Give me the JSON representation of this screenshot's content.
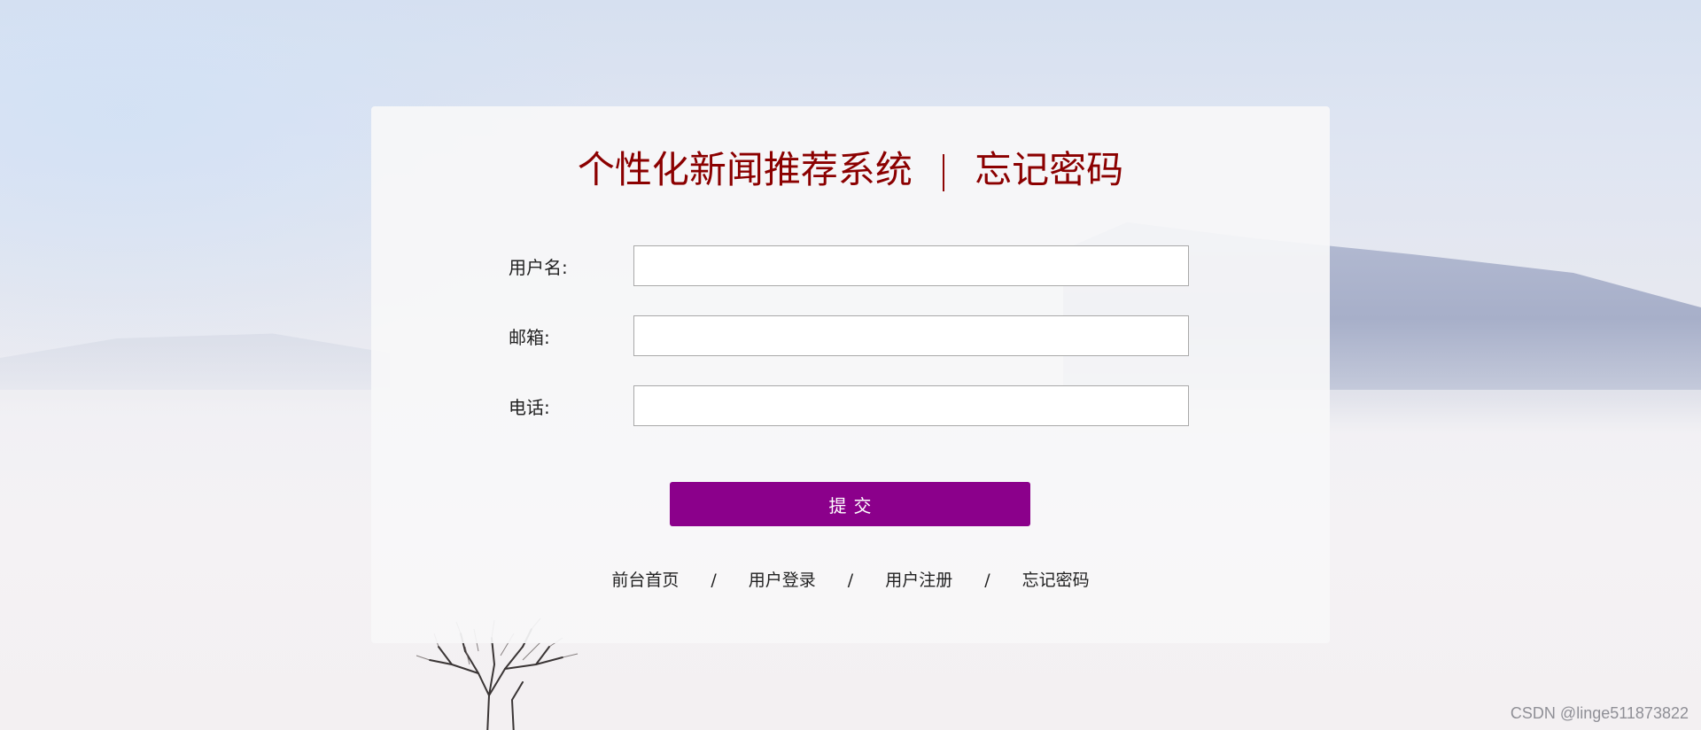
{
  "page": {
    "title_left": "个性化新闻推荐系统",
    "title_sep": "|",
    "title_right": "忘记密码"
  },
  "form": {
    "username_label": "用户名:",
    "username_value": "",
    "email_label": "邮箱:",
    "email_value": "",
    "phone_label": "电话:",
    "phone_value": "",
    "submit_label": "提交"
  },
  "nav_links": [
    {
      "label": "前台首页"
    },
    {
      "label": "用户登录"
    },
    {
      "label": "用户注册"
    },
    {
      "label": "忘记密码"
    }
  ],
  "nav_separator": "/",
  "watermark": "CSDN @linge511873822",
  "colors": {
    "title": "#8b0000",
    "submit_bg": "#8b008b",
    "submit_text": "#ffffff"
  }
}
